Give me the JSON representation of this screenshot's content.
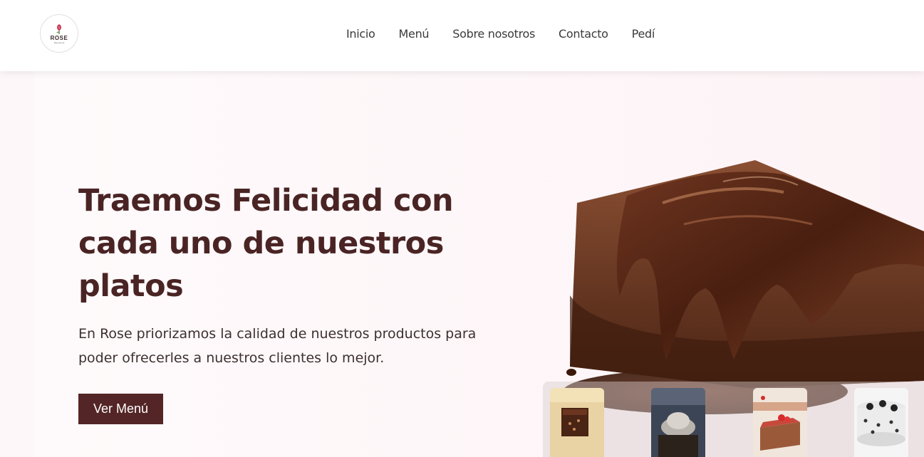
{
  "brand": {
    "logo_text": "ROSE",
    "logo_sub": "Reposteria"
  },
  "nav": {
    "items": [
      {
        "label": "Inicio"
      },
      {
        "label": "Menú"
      },
      {
        "label": "Sobre nosotros"
      },
      {
        "label": "Contacto"
      },
      {
        "label": "Pedí"
      }
    ]
  },
  "hero": {
    "title": "Traemos Felicidad con cada uno de nuestros platos",
    "subtitle": "En Rose priorizamos la calidad de nuestros productos para poder ofrecerles a nuestros clientes lo mejor.",
    "cta_label": "Ver Menú"
  },
  "colors": {
    "accent": "#542526",
    "title": "#4a2424",
    "background": "#fdf7f9"
  },
  "thumbnails": [
    {
      "icon": "brownie-thumbnail"
    },
    {
      "icon": "cupcakes-thumbnail"
    },
    {
      "icon": "cheesecake-thumbnail"
    },
    {
      "icon": "oreo-cake-thumbnail"
    }
  ]
}
